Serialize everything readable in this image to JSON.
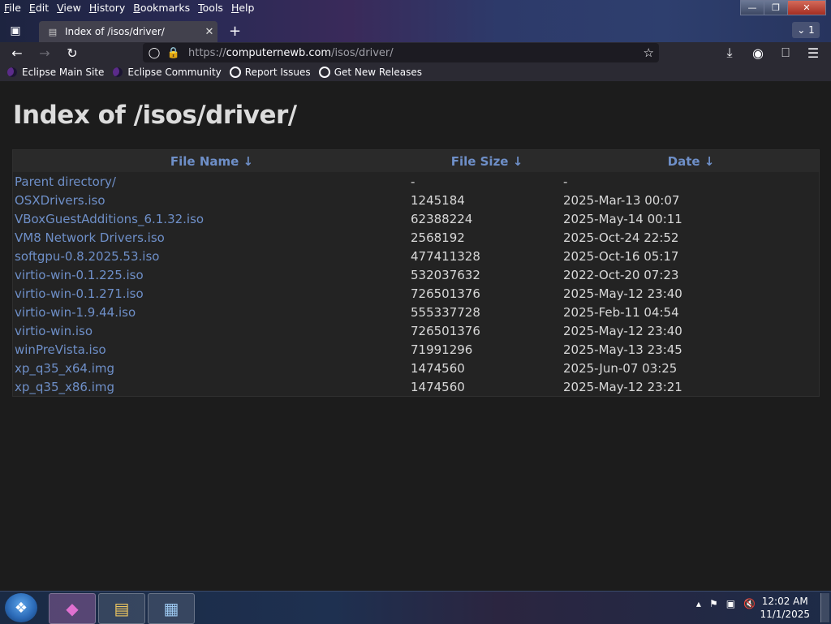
{
  "menu": [
    "File",
    "Edit",
    "View",
    "History",
    "Bookmarks",
    "Tools",
    "Help"
  ],
  "tab": {
    "title": "Index of /isos/driver/"
  },
  "tab_count": "1",
  "url": {
    "prefix": "https://",
    "host": "computernewb.com",
    "path": "/isos/driver/"
  },
  "bookmarks": [
    "Eclipse Main Site",
    "Eclipse Community",
    "Report Issues",
    "Get New Releases"
  ],
  "page": {
    "title": "Index of /isos/driver/",
    "columns": [
      "File Name  ↓",
      "File Size  ↓",
      "Date  ↓"
    ],
    "rows": [
      {
        "name": "Parent directory/",
        "size": "-",
        "date": "-"
      },
      {
        "name": "OSXDrivers.iso",
        "size": "1245184",
        "date": "2025-Mar-13 00:07"
      },
      {
        "name": "VBoxGuestAdditions_6.1.32.iso",
        "size": "62388224",
        "date": "2025-May-14 00:11"
      },
      {
        "name": "VM8 Network Drivers.iso",
        "size": "2568192",
        "date": "2025-Oct-24 22:52"
      },
      {
        "name": "softgpu-0.8.2025.53.iso",
        "size": "477411328",
        "date": "2025-Oct-16 05:17"
      },
      {
        "name": "virtio-win-0.1.225.iso",
        "size": "532037632",
        "date": "2022-Oct-20 07:23"
      },
      {
        "name": "virtio-win-0.1.271.iso",
        "size": "726501376",
        "date": "2025-May-12 23:40"
      },
      {
        "name": "virtio-win-1.9.44.iso",
        "size": "555337728",
        "date": "2025-Feb-11 04:54"
      },
      {
        "name": "virtio-win.iso",
        "size": "726501376",
        "date": "2025-May-12 23:40"
      },
      {
        "name": "winPreVista.iso",
        "size": "71991296",
        "date": "2025-May-13 23:45"
      },
      {
        "name": "xp_q35_x64.img",
        "size": "1474560",
        "date": "2025-Jun-07 03:25"
      },
      {
        "name": "xp_q35_x86.img",
        "size": "1474560",
        "date": "2025-May-12 23:21"
      }
    ]
  },
  "clock": {
    "time": "12:02 AM",
    "date": "11/1/2025"
  },
  "colors": {
    "link": "#6e8fc8",
    "background": "#1c1c1c"
  }
}
